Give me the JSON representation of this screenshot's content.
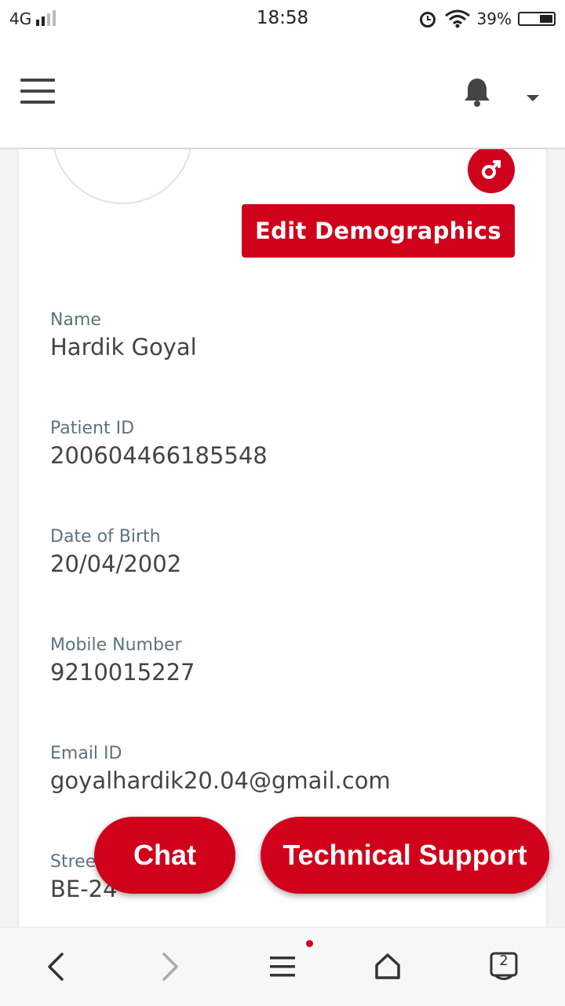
{
  "status_bar": {
    "network": "4G",
    "time": "18:58",
    "battery": "39%"
  },
  "header": {
    "menu_icon": "hamburger-icon",
    "notification_icon": "bell-icon",
    "dropdown_icon": "caret-down-icon"
  },
  "profile": {
    "gender_icon": "male-icon",
    "edit_button": "Edit Demographics",
    "fields": [
      {
        "label": "Name",
        "value": "Hardik Goyal"
      },
      {
        "label": "Patient ID",
        "value": "200604466185548"
      },
      {
        "label": "Date of Birth",
        "value": "20/04/2002"
      },
      {
        "label": "Mobile Number",
        "value": "9210015227"
      },
      {
        "label": "Email ID",
        "value": "goyalhardik20.04@gmail.com"
      },
      {
        "label": "Stree",
        "value": "BE-24"
      }
    ]
  },
  "floating": {
    "chat": "Chat",
    "support": "Technical Support"
  },
  "browser_bar": {
    "tabs_count": "2"
  },
  "colors": {
    "accent": "#d0021b",
    "label": "#5d7280",
    "value": "#444444"
  }
}
